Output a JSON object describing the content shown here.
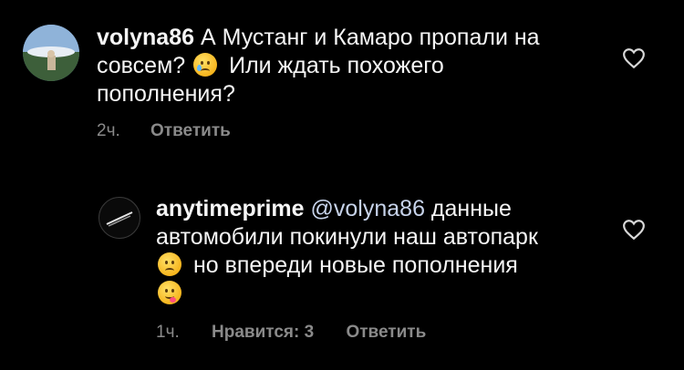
{
  "comments": [
    {
      "username": "volyna86",
      "line1": "А Мустанг и Камаро пропали на",
      "line2_pre": "совсем?",
      "line2_post": "Или ждать похожего",
      "line3": "пополнения?",
      "emoji_icon": "crying-face-icon",
      "time": "2ч.",
      "reply_label": "Ответить"
    },
    {
      "username": "anytimeprime",
      "mention": "@volyna86",
      "line1_rest": "данные",
      "line2": "автомобили покинули наш автопарк",
      "line3": "но впереди новые пополнения",
      "emoji_icon_1": "slightly-frowning-face-icon",
      "emoji_icon_2": "savoring-food-face-icon",
      "time": "1ч.",
      "likes_label": "Нравится: 3",
      "reply_label": "Ответить"
    }
  ]
}
